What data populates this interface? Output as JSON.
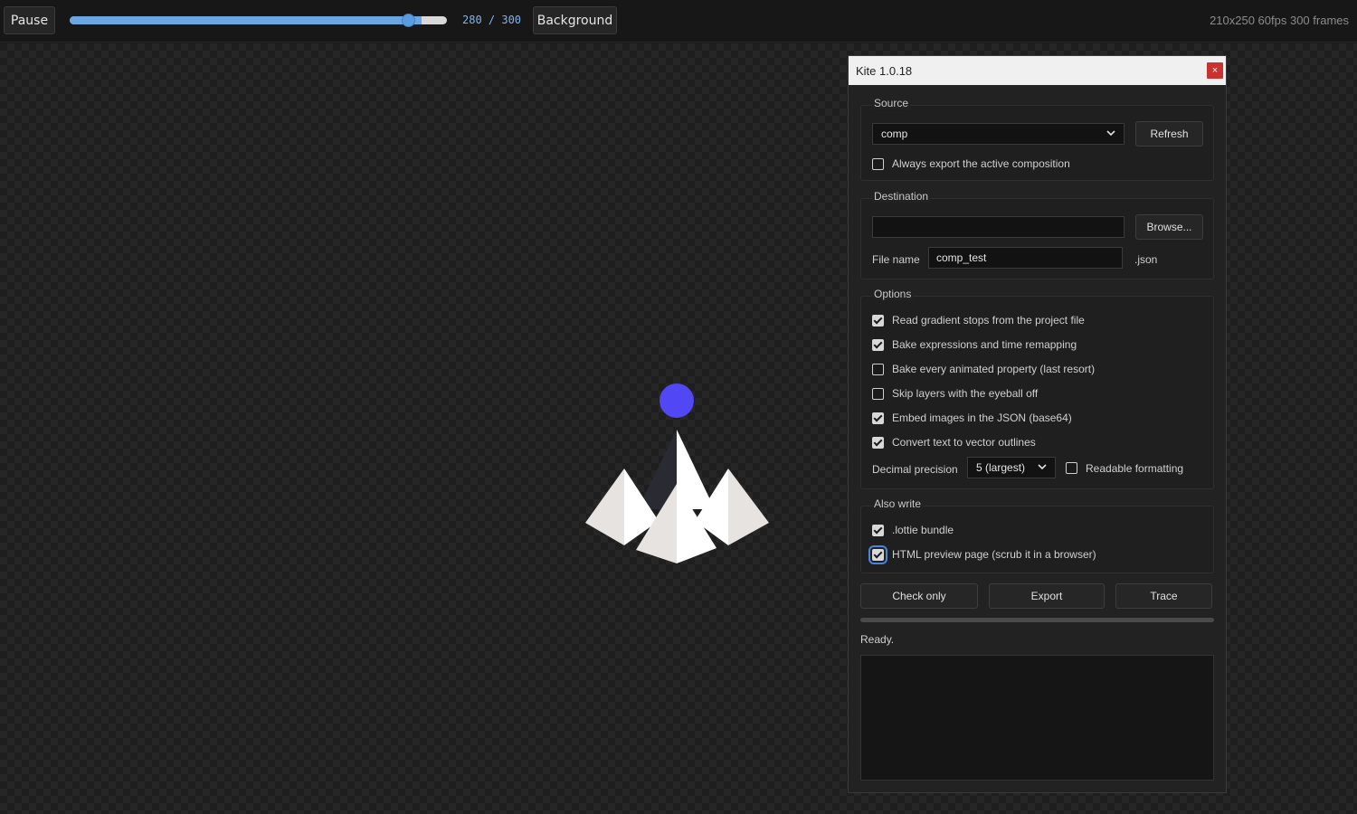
{
  "toolbar": {
    "pause_label": "Pause",
    "background_label": "Background",
    "frame_current": "280",
    "frame_total": "300",
    "frame_readout": "280 / 300",
    "progress_fraction": 0.9333,
    "meta": "210x250 60fps 300 frames"
  },
  "panel": {
    "title": "Kite 1.0.18",
    "close_label": "×",
    "source": {
      "label": "Source",
      "selected": "comp",
      "refresh_label": "Refresh",
      "always_export_label": "Always export the active composition",
      "always_export_checked": false
    },
    "destination": {
      "label": "Destination",
      "path_value": "",
      "browse_label": "Browse...",
      "filename_label": "File name",
      "filename_value": "comp_test",
      "extension": ".json"
    },
    "options": {
      "label": "Options",
      "items": [
        {
          "label": "Read gradient stops from the project file",
          "checked": true
        },
        {
          "label": "Bake expressions and time remapping",
          "checked": true
        },
        {
          "label": "Bake every animated property (last resort)",
          "checked": false
        },
        {
          "label": "Skip layers with the eyeball off",
          "checked": false
        },
        {
          "label": "Embed images in the JSON (base64)",
          "checked": true
        },
        {
          "label": "Convert text to vector outlines",
          "checked": true
        }
      ],
      "precision_label": "Decimal precision",
      "precision_value": "5 (largest)",
      "readable_label": "Readable formatting",
      "readable_checked": false
    },
    "also_write": {
      "label": "Also write",
      "items": [
        {
          "label": ".lottie bundle",
          "checked": true
        },
        {
          "label": "HTML preview page (scrub it in a browser)",
          "checked": true
        }
      ]
    },
    "actions": {
      "check_label": "Check only",
      "export_label": "Export",
      "trace_label": "Trace"
    },
    "export_progress": 0,
    "status": "Ready."
  },
  "colors": {
    "accent": "#5b9be0",
    "ball": "#5247f5",
    "close": "#c8332f",
    "shape_light": "#e6e3e1",
    "shape_white": "#ffffff",
    "shape_dark": "#2a2a33"
  },
  "icons": {
    "dropdown": "chevron-down-icon",
    "close": "close-icon"
  }
}
